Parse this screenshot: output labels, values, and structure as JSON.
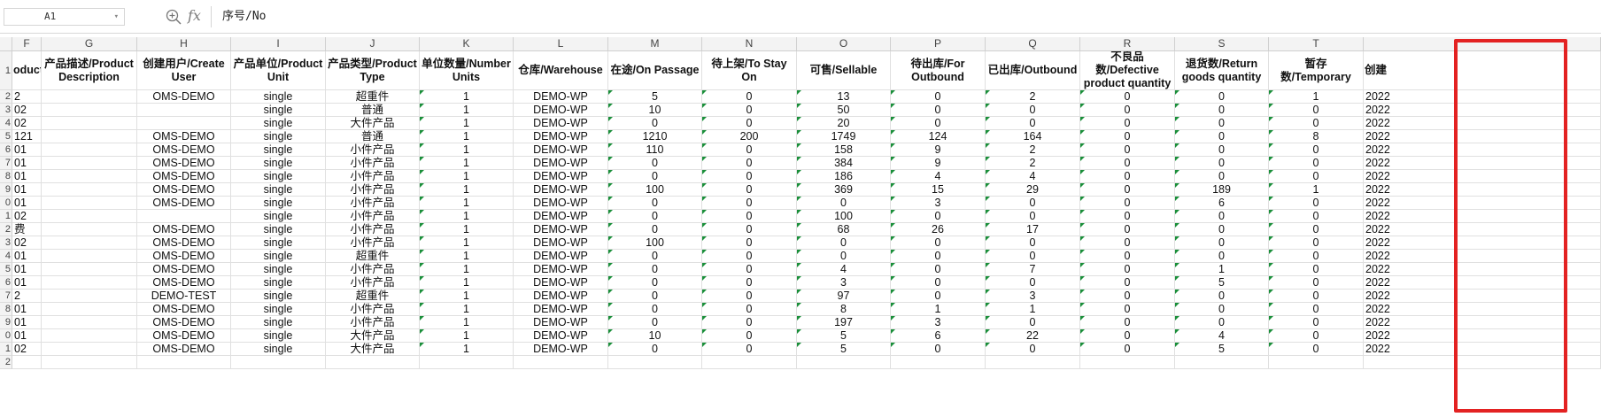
{
  "name_box": {
    "value": "A1"
  },
  "formula": {
    "value": "序号/No"
  },
  "colors": {
    "highlight": "#e32222",
    "number_flag": "#1a8f3a",
    "header_bg": "#f3f3f3"
  },
  "column_letters": [
    "F",
    "G",
    "H",
    "I",
    "J",
    "K",
    "L",
    "M",
    "N",
    "O",
    "P",
    "Q",
    "R",
    "S",
    "T",
    ""
  ],
  "headers": [
    "oduct",
    "产品描述/Product Description",
    "创建用户/Create User",
    "产品单位/Product Unit",
    "产品类型/Product Type",
    "单位数量/Number Units",
    "仓库/Warehouse",
    "在途/On Passage",
    "待上架/To Stay On",
    "可售/Sellable",
    "待出库/For Outbound",
    "已出库/Outbound",
    "不良品数/Defective product quantity",
    "退货数/Return goods quantity",
    "暂存数/Temporary",
    "创建"
  ],
  "row_numbers": [
    "2",
    "3",
    "4",
    "5",
    "6",
    "7",
    "8",
    "9",
    "0",
    "1",
    "2",
    "3",
    "4",
    "5",
    "6",
    "7",
    "8",
    "9",
    "0",
    "1",
    "2"
  ],
  "rows": [
    [
      "2",
      "",
      "OMS-DEMO",
      "single",
      "超重件",
      "1",
      "DEMO-WP",
      "5",
      "0",
      "13",
      "0",
      "2",
      "0",
      "0",
      "1",
      "2022"
    ],
    [
      "02",
      "",
      "",
      "single",
      "普通",
      "1",
      "DEMO-WP",
      "10",
      "0",
      "50",
      "0",
      "0",
      "0",
      "0",
      "0",
      "2022"
    ],
    [
      "02",
      "",
      "",
      "single",
      "大件产品",
      "1",
      "DEMO-WP",
      "0",
      "0",
      "20",
      "0",
      "0",
      "0",
      "0",
      "0",
      "2022"
    ],
    [
      "121",
      "",
      "OMS-DEMO",
      "single",
      "普通",
      "1",
      "DEMO-WP",
      "1210",
      "200",
      "1749",
      "124",
      "164",
      "0",
      "0",
      "8",
      "2022"
    ],
    [
      "01",
      "",
      "OMS-DEMO",
      "single",
      "小件产品",
      "1",
      "DEMO-WP",
      "110",
      "0",
      "158",
      "9",
      "2",
      "0",
      "0",
      "0",
      "2022"
    ],
    [
      "01",
      "",
      "OMS-DEMO",
      "single",
      "小件产品",
      "1",
      "DEMO-WP",
      "0",
      "0",
      "384",
      "9",
      "2",
      "0",
      "0",
      "0",
      "2022"
    ],
    [
      "01",
      "",
      "OMS-DEMO",
      "single",
      "小件产品",
      "1",
      "DEMO-WP",
      "0",
      "0",
      "186",
      "4",
      "4",
      "0",
      "0",
      "0",
      "2022"
    ],
    [
      "01",
      "",
      "OMS-DEMO",
      "single",
      "小件产品",
      "1",
      "DEMO-WP",
      "100",
      "0",
      "369",
      "15",
      "29",
      "0",
      "189",
      "1",
      "2022"
    ],
    [
      "01",
      "",
      "OMS-DEMO",
      "single",
      "小件产品",
      "1",
      "DEMO-WP",
      "0",
      "0",
      "0",
      "3",
      "0",
      "0",
      "6",
      "0",
      "2022"
    ],
    [
      "02",
      "",
      "",
      "single",
      "小件产品",
      "1",
      "DEMO-WP",
      "0",
      "0",
      "100",
      "0",
      "0",
      "0",
      "0",
      "0",
      "2022"
    ],
    [
      "费",
      "",
      "OMS-DEMO",
      "single",
      "小件产品",
      "1",
      "DEMO-WP",
      "0",
      "0",
      "68",
      "26",
      "17",
      "0",
      "0",
      "0",
      "2022"
    ],
    [
      "02",
      "",
      "OMS-DEMO",
      "single",
      "小件产品",
      "1",
      "DEMO-WP",
      "100",
      "0",
      "0",
      "0",
      "0",
      "0",
      "0",
      "0",
      "2022"
    ],
    [
      "01",
      "",
      "OMS-DEMO",
      "single",
      "超重件",
      "1",
      "DEMO-WP",
      "0",
      "0",
      "0",
      "0",
      "0",
      "0",
      "0",
      "0",
      "2022"
    ],
    [
      "01",
      "",
      "OMS-DEMO",
      "single",
      "小件产品",
      "1",
      "DEMO-WP",
      "0",
      "0",
      "4",
      "0",
      "7",
      "0",
      "1",
      "0",
      "2022"
    ],
    [
      "01",
      "",
      "OMS-DEMO",
      "single",
      "小件产品",
      "1",
      "DEMO-WP",
      "0",
      "0",
      "3",
      "0",
      "0",
      "0",
      "5",
      "0",
      "2022"
    ],
    [
      "2",
      "",
      "DEMO-TEST",
      "single",
      "超重件",
      "1",
      "DEMO-WP",
      "0",
      "0",
      "97",
      "0",
      "3",
      "0",
      "0",
      "0",
      "2022"
    ],
    [
      "01",
      "",
      "OMS-DEMO",
      "single",
      "小件产品",
      "1",
      "DEMO-WP",
      "0",
      "0",
      "8",
      "1",
      "1",
      "0",
      "0",
      "0",
      "2022"
    ],
    [
      "01",
      "",
      "OMS-DEMO",
      "single",
      "小件产品",
      "1",
      "DEMO-WP",
      "0",
      "0",
      "197",
      "3",
      "0",
      "0",
      "0",
      "0",
      "2022"
    ],
    [
      "01",
      "",
      "OMS-DEMO",
      "single",
      "大件产品",
      "1",
      "DEMO-WP",
      "10",
      "0",
      "5",
      "6",
      "22",
      "0",
      "4",
      "0",
      "2022"
    ],
    [
      "02",
      "",
      "OMS-DEMO",
      "single",
      "大件产品",
      "1",
      "DEMO-WP",
      "0",
      "0",
      "5",
      "0",
      "0",
      "0",
      "5",
      "0",
      "2022"
    ],
    [
      "",
      "",
      "",
      "",
      "",
      "",
      "",
      "",
      "",
      "",
      "",
      "",
      "",
      "",
      "",
      ""
    ]
  ]
}
